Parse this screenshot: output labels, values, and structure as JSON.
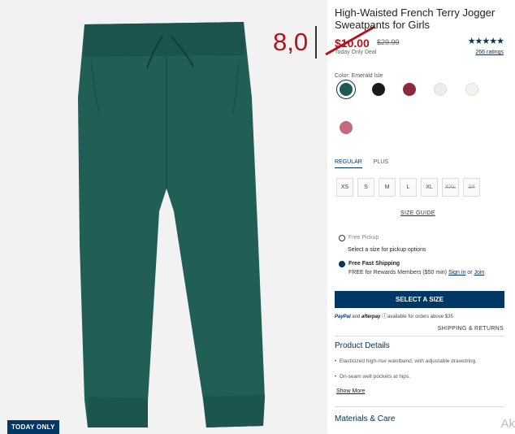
{
  "badge": "TODAY ONLY",
  "annotation": "8,0",
  "product": {
    "title": "High-Waisted French Terry Jogger Sweatpants for Girls",
    "price": "$10.00",
    "old_price": "$29.99",
    "deal": "Today Only Deal",
    "stars": "★★★★★",
    "ratings": "266 ratings",
    "color_label": "Color: Emerald Isle",
    "swatches": [
      {
        "name": "emerald",
        "color": "#1e5a52",
        "selected": true
      },
      {
        "name": "black",
        "color": "#1a1a1a"
      },
      {
        "name": "burgundy",
        "color": "#8c2a3c"
      },
      {
        "name": "cream",
        "color": "#ececea"
      },
      {
        "name": "ivory",
        "color": "#f4f4ee"
      },
      {
        "name": "rose",
        "color": "#c46a7e"
      }
    ]
  },
  "tabs": [
    "REGULAR",
    "PLUS"
  ],
  "sizes": [
    {
      "label": "XS",
      "available": true
    },
    {
      "label": "S",
      "available": true
    },
    {
      "label": "M",
      "available": true
    },
    {
      "label": "L",
      "available": true
    },
    {
      "label": "XL",
      "available": true
    },
    {
      "label": "XXL",
      "available": false
    },
    {
      "label": "3X",
      "available": false
    }
  ],
  "size_guide": "SIZE GUIDE",
  "pickup": {
    "label": "Free Pickup",
    "hint": "Select a size for pickup options"
  },
  "shipping": {
    "label": "Free Fast Shipping",
    "line": "FREE for Rewards Members ($50 min)",
    "signin": "Sign in",
    "or": "or",
    "join": "Join"
  },
  "cta": "SELECT A SIZE",
  "paypal": {
    "pp": "PayPal",
    "and": "and",
    "ap": "afterpay",
    "note": "available for orders above $35"
  },
  "ship_returns": "SHIPPING & RETURNS",
  "details": {
    "heading": "Product Details",
    "bullets": [
      "Elasticized high-rise waistband, with adjustable drawstring.",
      "On-seam welt pockets at hips."
    ],
    "more": "Show More"
  },
  "materials": {
    "heading": "Materials & Care"
  },
  "corner": "Ak"
}
